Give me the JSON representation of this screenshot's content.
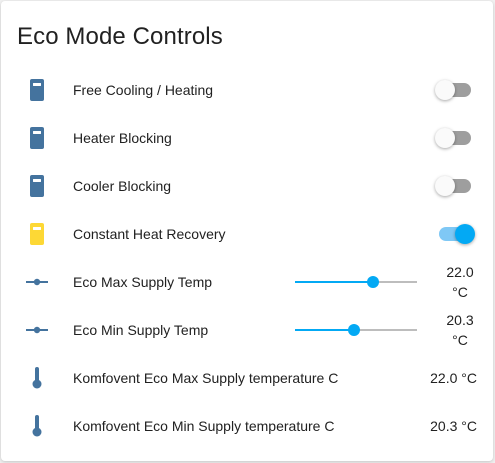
{
  "card": {
    "title": "Eco Mode Controls"
  },
  "colors": {
    "icon_default": "#44739e",
    "icon_active": "#fdd835",
    "accent": "#03a9f4"
  },
  "rows": [
    {
      "label": "Free Cooling / Heating",
      "icon": "device-icon",
      "toggle_on": false
    },
    {
      "label": "Heater Blocking",
      "icon": "device-icon",
      "toggle_on": false
    },
    {
      "label": "Cooler Blocking",
      "icon": "device-icon",
      "toggle_on": false
    },
    {
      "label": "Constant Heat Recovery",
      "icon": "device-icon-active",
      "toggle_on": true
    },
    {
      "label": "Eco Max Supply Temp",
      "icon": "slider-icon",
      "value_line1": "22.0",
      "value_line2": "°C",
      "slider_fraction": 0.64
    },
    {
      "label": "Eco Min Supply Temp",
      "icon": "slider-icon",
      "value_line1": "20.3",
      "value_line2": "°C",
      "slider_fraction": 0.48
    },
    {
      "label": "Komfovent Eco Max Supply temperature C",
      "icon": "thermometer-icon",
      "value": "22.0 °C"
    },
    {
      "label": "Komfovent Eco Min Supply temperature C",
      "icon": "thermometer-icon",
      "value": "20.3 °C"
    }
  ]
}
